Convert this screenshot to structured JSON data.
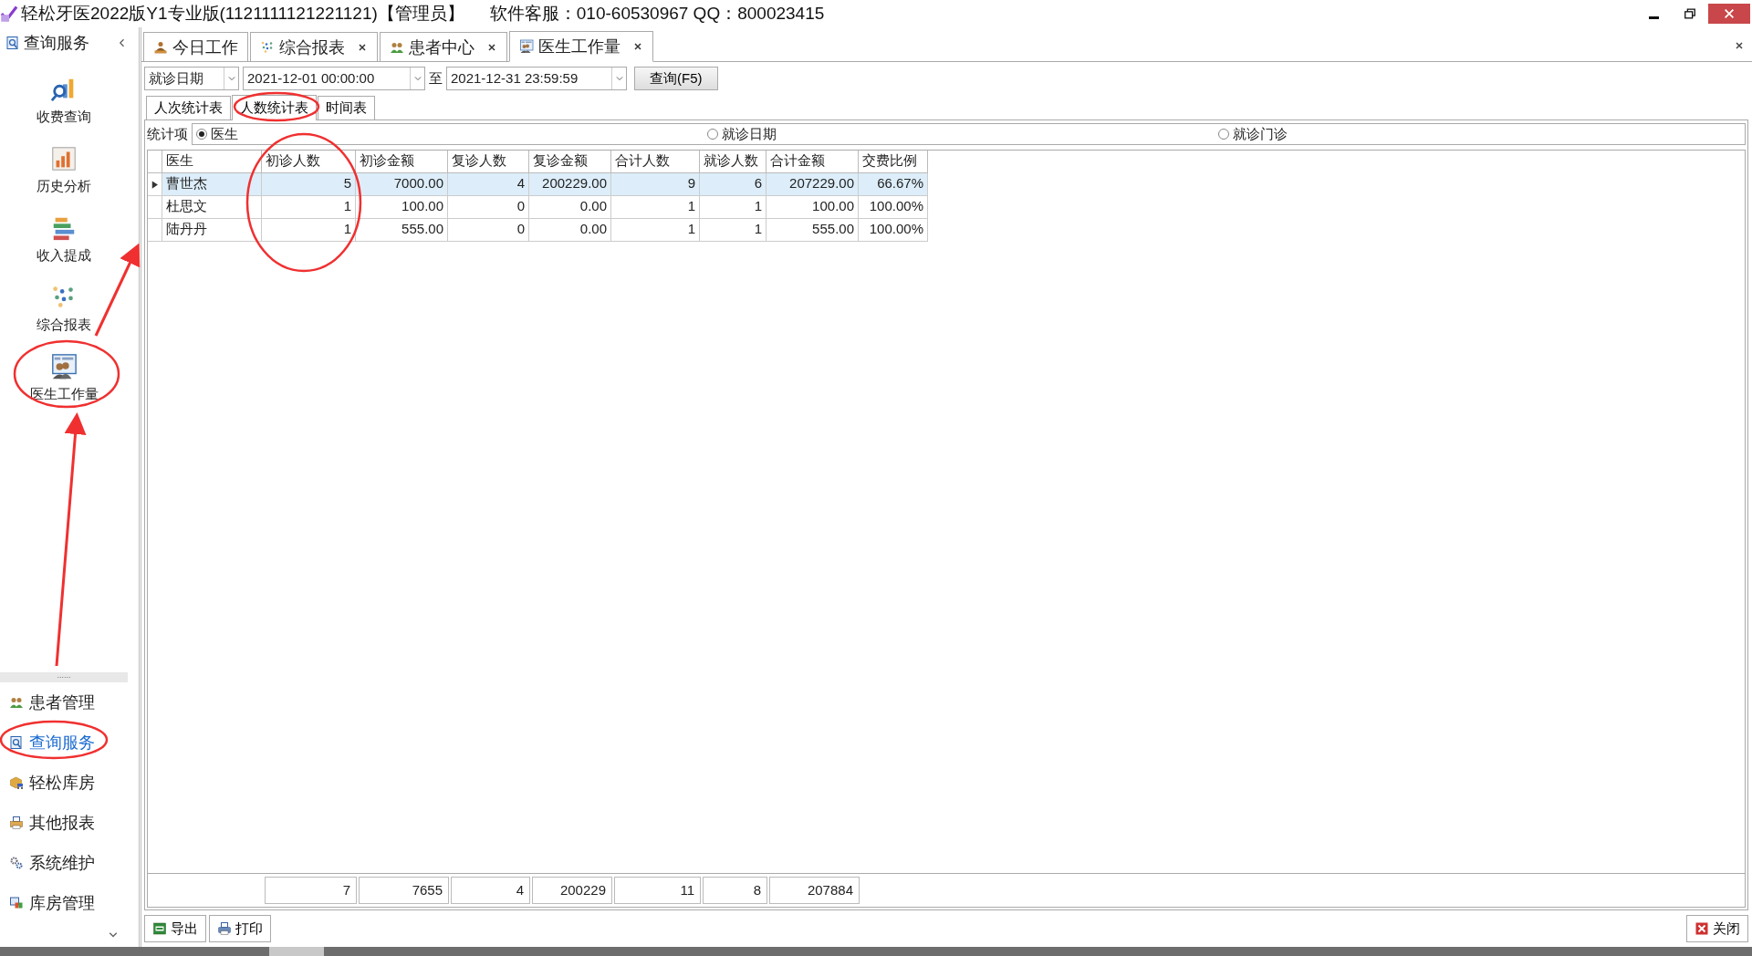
{
  "window": {
    "title": "轻松牙医2022版Y1专业版(1121111121221121)【管理员】",
    "support": "软件客服：010-60530967 QQ：800023415"
  },
  "sidebar": {
    "title": "查询服务",
    "items": [
      {
        "label": "收费查询",
        "kind": "search-chart"
      },
      {
        "label": "历史分析",
        "kind": "bar-chart"
      },
      {
        "label": "收入提成",
        "kind": "stack"
      },
      {
        "label": "综合报表",
        "kind": "dots"
      },
      {
        "label": "医生工作量",
        "kind": "doctors"
      }
    ],
    "splitter": "......",
    "nav": [
      {
        "label": "患者管理",
        "kind": "people",
        "selected": false
      },
      {
        "label": "查询服务",
        "kind": "search",
        "selected": true
      },
      {
        "label": "轻松库房",
        "kind": "box",
        "selected": false
      },
      {
        "label": "其他报表",
        "kind": "printer",
        "selected": false
      },
      {
        "label": "系统维护",
        "kind": "gears",
        "selected": false
      },
      {
        "label": "库房管理",
        "kind": "windows",
        "selected": false
      }
    ]
  },
  "tabs": [
    {
      "label": "今日工作",
      "kind": "person",
      "closable": false,
      "selected": false
    },
    {
      "label": "综合报表",
      "kind": "dots",
      "closable": true,
      "selected": false
    },
    {
      "label": "患者中心",
      "kind": "people",
      "closable": true,
      "selected": false
    },
    {
      "label": "医生工作量",
      "kind": "doctors",
      "closable": true,
      "selected": true
    }
  ],
  "filter": {
    "field": "就诊日期",
    "from": "2021-12-01 00:00:00",
    "to_label": "至",
    "to": "2021-12-31 23:59:59",
    "button": "查询(F5)"
  },
  "sub_tabs": [
    {
      "label": "人次统计表",
      "selected": false
    },
    {
      "label": "人数统计表",
      "selected": true
    },
    {
      "label": "时间表",
      "selected": false
    }
  ],
  "group_by": {
    "label": "统计项",
    "options": [
      {
        "label": "医生",
        "selected": true
      },
      {
        "label": "就诊日期",
        "selected": false
      },
      {
        "label": "就诊门诊",
        "selected": false
      }
    ]
  },
  "table": {
    "columns": [
      "医生",
      "初诊人数",
      "初诊金额",
      "复诊人数",
      "复诊金额",
      "合计人数",
      "就诊人数",
      "合计金额",
      "交费比例"
    ],
    "rows": [
      {
        "selected": true,
        "cells": [
          "曹世杰",
          "5",
          "7000.00",
          "4",
          "200229.00",
          "9",
          "6",
          "207229.00",
          "66.67%"
        ]
      },
      {
        "selected": false,
        "cells": [
          "杜思文",
          "1",
          "100.00",
          "0",
          "0.00",
          "1",
          "1",
          "100.00",
          "100.00%"
        ]
      },
      {
        "selected": false,
        "cells": [
          "陆丹丹",
          "1",
          "555.00",
          "0",
          "0.00",
          "1",
          "1",
          "555.00",
          "100.00%"
        ]
      }
    ],
    "totals": [
      "7",
      "7655",
      "4",
      "200229",
      "11",
      "8",
      "207884"
    ]
  },
  "actions": [
    {
      "label": "导出",
      "kind": "export"
    },
    {
      "label": "打印",
      "kind": "print"
    }
  ],
  "close_button": "关闭"
}
